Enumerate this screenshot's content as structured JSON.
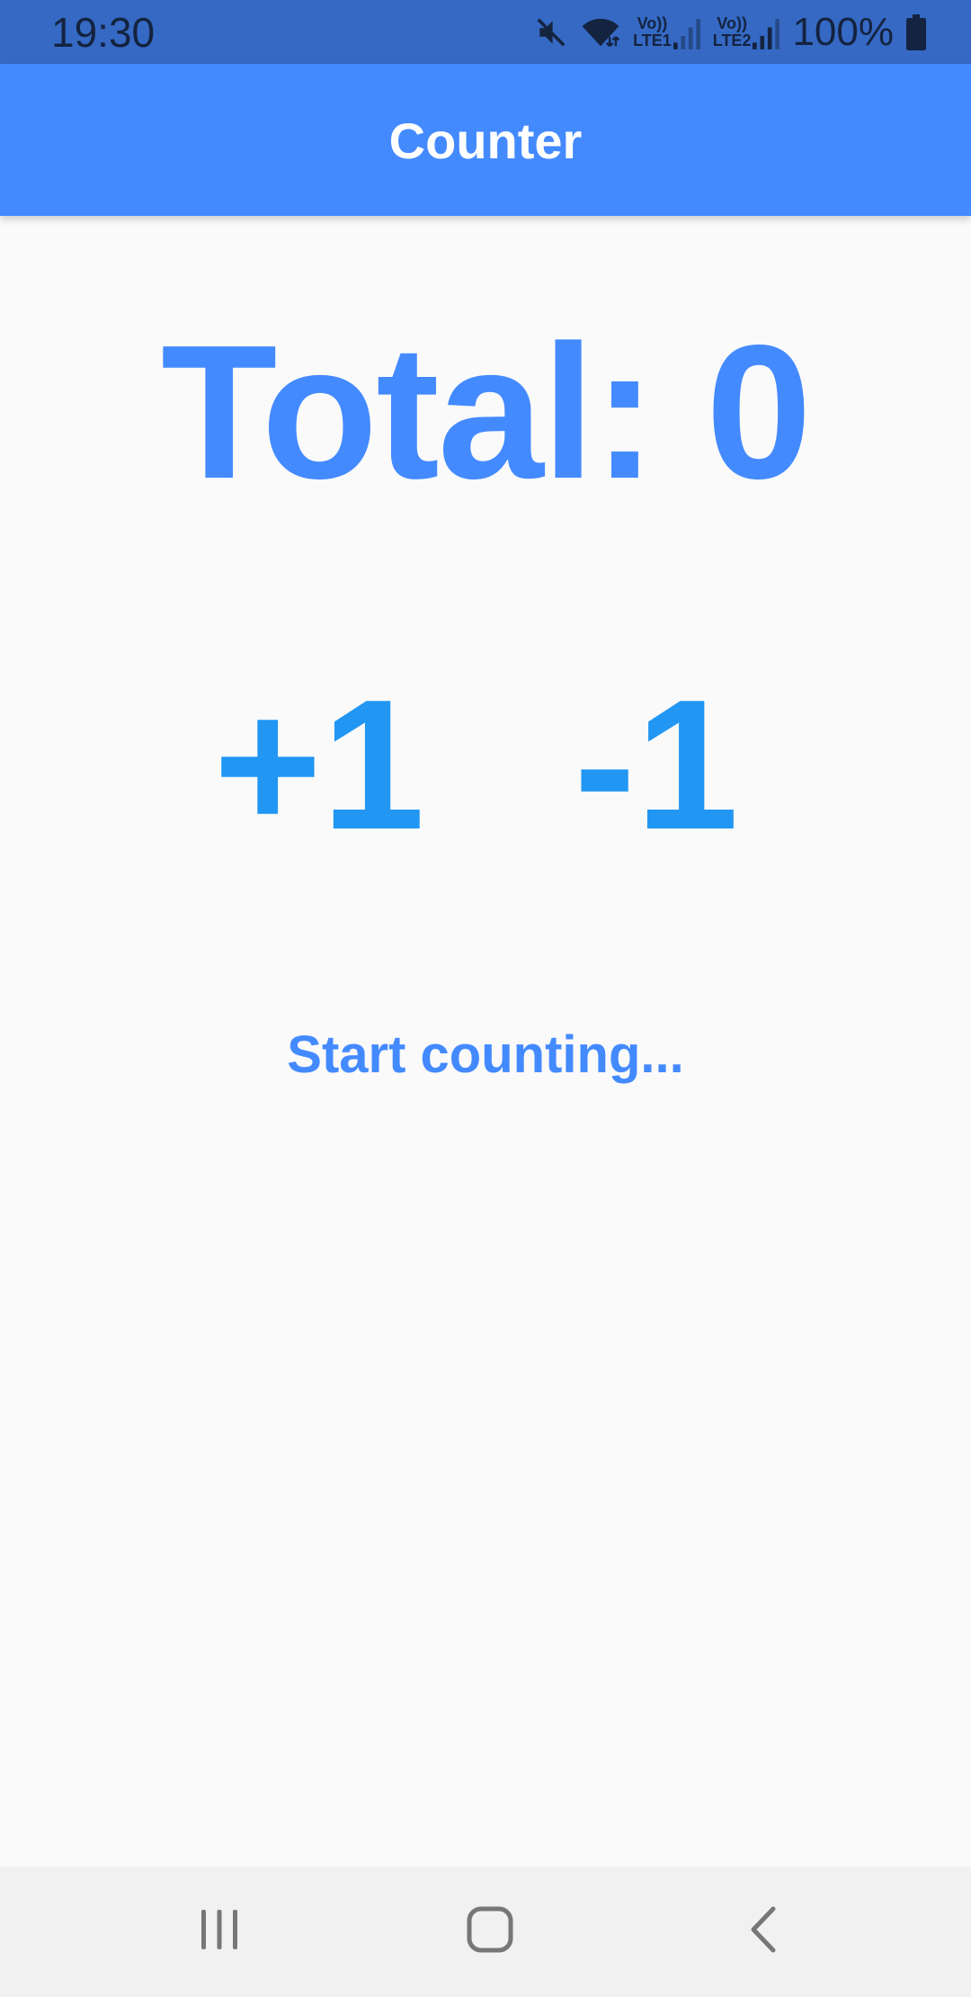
{
  "status_bar": {
    "time": "19:30",
    "sim1_label_top": "Vo))",
    "sim1_label_bottom": "LTE1",
    "sim2_label_top": "Vo))",
    "sim2_label_bottom": "LTE2",
    "battery_percent": "100%",
    "icons": [
      "mute-icon",
      "wifi-icon",
      "signal-icon",
      "signal-icon",
      "battery-icon"
    ]
  },
  "app_bar": {
    "title": "Counter",
    "color": "#448aff"
  },
  "main": {
    "total_text": "Total: 0",
    "increment_label": "+1",
    "decrement_label": "-1",
    "hint_text": "Start counting..."
  },
  "nav_bar": {
    "icons": [
      "recents-icon",
      "home-icon",
      "back-icon"
    ]
  },
  "colors": {
    "status_bar": "#3569c4",
    "primary": "#448aff",
    "button_text": "#2196f3",
    "background": "#fafafa",
    "nav_bar": "#f1f1f1"
  }
}
